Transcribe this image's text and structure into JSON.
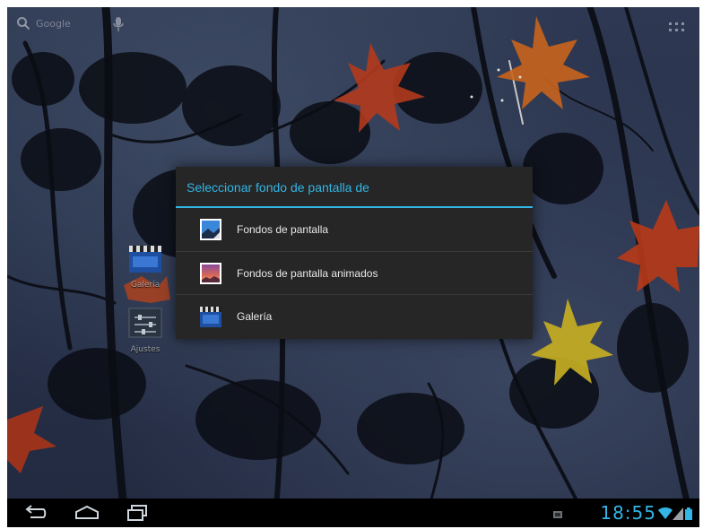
{
  "top_bar": {
    "search_label": "Google",
    "search_icon": "search-icon",
    "mic_icon": "mic-icon",
    "apps_icon": "apps-grid-icon"
  },
  "desktop": {
    "shortcuts": [
      {
        "label": "Galería",
        "icon": "gallery-icon"
      },
      {
        "label": "Ajustes",
        "icon": "settings-icon"
      }
    ]
  },
  "dialog": {
    "title": "Seleccionar fondo de pantalla de",
    "options": [
      {
        "label": "Fondos de pantalla",
        "icon": "wallpapers-icon"
      },
      {
        "label": "Fondos de pantalla animados",
        "icon": "live-wallpapers-icon"
      },
      {
        "label": "Galería",
        "icon": "gallery-icon"
      }
    ]
  },
  "nav_bar": {
    "back_icon": "back-icon",
    "home_icon": "home-icon",
    "recents_icon": "recent-apps-icon"
  },
  "status_bar": {
    "time": "18:55",
    "icons": [
      "notification-icon",
      "wifi-icon",
      "signal-icon",
      "battery-icon"
    ]
  },
  "colors": {
    "accent": "#33b5e5",
    "dialog_bg": "#262626",
    "nav_bg": "#000000"
  }
}
